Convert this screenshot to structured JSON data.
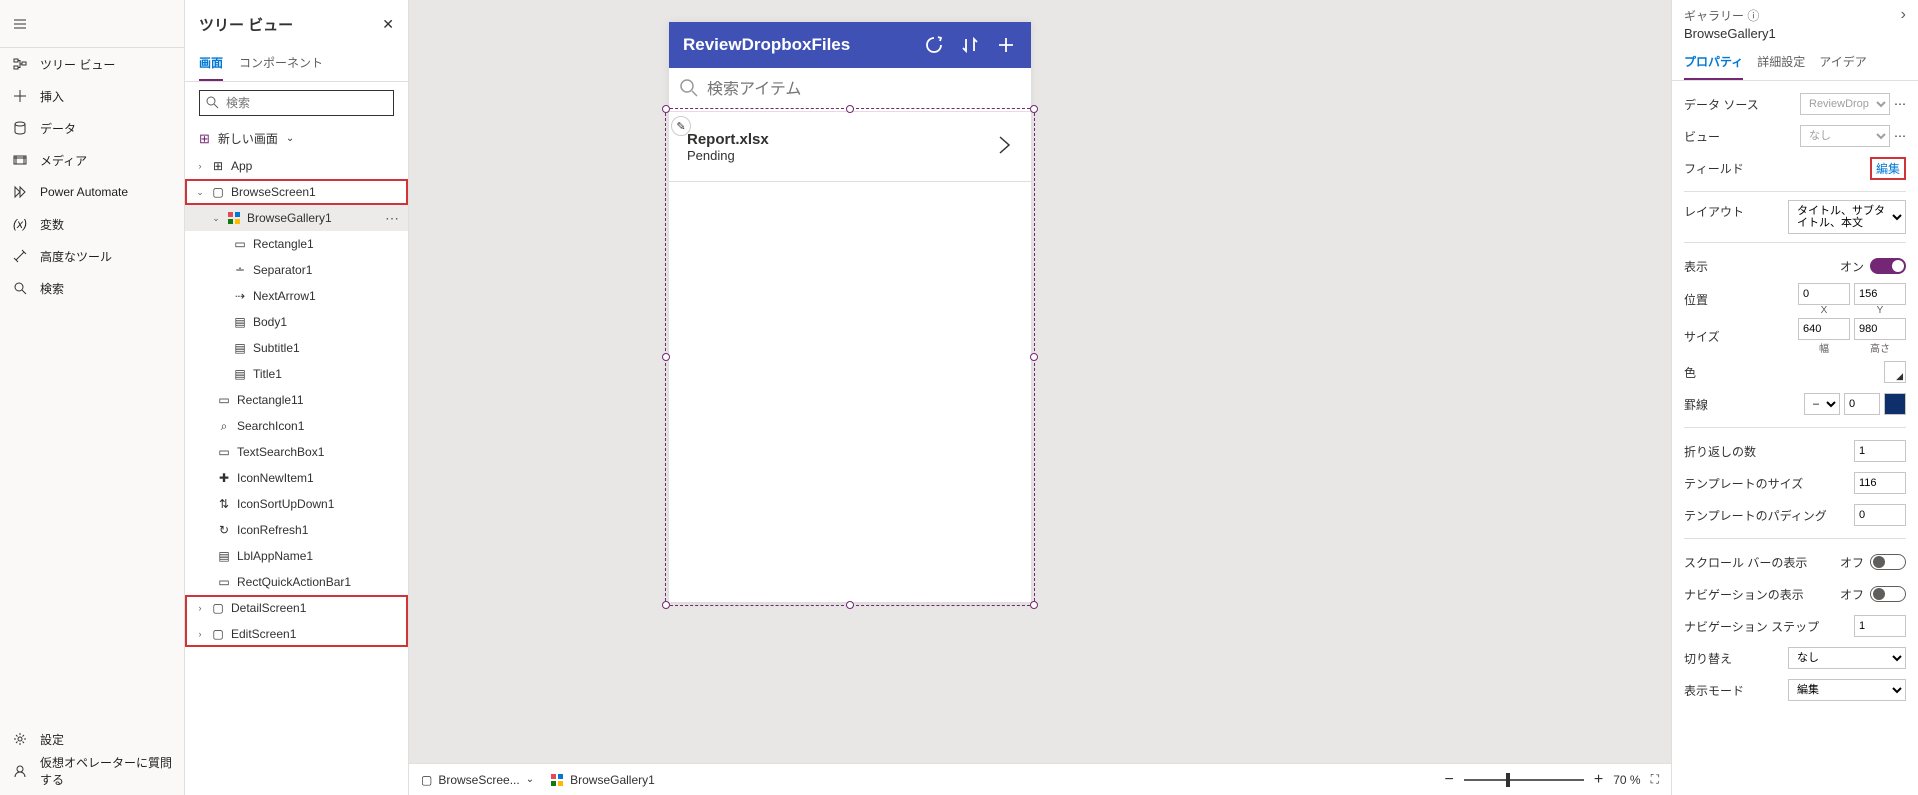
{
  "leftRail": {
    "items": [
      {
        "label": "ツリー ビュー",
        "icon": "tree"
      },
      {
        "label": "挿入",
        "icon": "plus"
      },
      {
        "label": "データ",
        "icon": "data"
      },
      {
        "label": "メディア",
        "icon": "media"
      },
      {
        "label": "Power Automate",
        "icon": "flow"
      },
      {
        "label": "変数",
        "icon": "var"
      },
      {
        "label": "高度なツール",
        "icon": "tools"
      },
      {
        "label": "検索",
        "icon": "search"
      }
    ],
    "bottom": [
      {
        "label": "設定",
        "icon": "gear"
      },
      {
        "label": "仮想オペレーターに質問する",
        "icon": "bot"
      }
    ]
  },
  "treePanel": {
    "title": "ツリー ビュー",
    "tabs": [
      "画面",
      "コンポーネント"
    ],
    "searchPlaceholder": "検索",
    "newScreen": "新しい画面",
    "nodes": {
      "app": "App",
      "browseScreen": "BrowseScreen1",
      "browseGallery": "BrowseGallery1",
      "rectangle1": "Rectangle1",
      "separator1": "Separator1",
      "nextArrow1": "NextArrow1",
      "body1": "Body1",
      "subtitle1": "Subtitle1",
      "title1": "Title1",
      "rectangle11": "Rectangle11",
      "searchIcon1": "SearchIcon1",
      "textSearchBox1": "TextSearchBox1",
      "iconNewItem1": "IconNewItem1",
      "iconSortUpDown1": "IconSortUpDown1",
      "iconRefresh1": "IconRefresh1",
      "lblAppName1": "LblAppName1",
      "rectQuickActionBar1": "RectQuickActionBar1",
      "detailScreen": "DetailScreen1",
      "editScreen": "EditScreen1"
    }
  },
  "appPreview": {
    "title": "ReviewDropboxFiles",
    "searchPlaceholder": "検索アイテム",
    "item": {
      "title": "Report.xlsx",
      "subtitle": "Pending"
    }
  },
  "bottomBar": {
    "screen": "BrowseScree...",
    "gallery": "BrowseGallery1",
    "zoom": "70",
    "zoomSuffix": "%"
  },
  "rightPanel": {
    "type": "ギャラリー",
    "name": "BrowseGallery1",
    "tabs": [
      "プロパティ",
      "詳細設定",
      "アイデア"
    ],
    "rows": {
      "dataSource": {
        "label": "データ ソース",
        "value": "ReviewDropbo..."
      },
      "view": {
        "label": "ビュー",
        "value": "なし"
      },
      "fields": {
        "label": "フィールド",
        "edit": "編集"
      },
      "layout": {
        "label": "レイアウト",
        "value": "タイトル、サブタイトル、本文"
      },
      "visible": {
        "label": "表示",
        "state": "オン"
      },
      "position": {
        "label": "位置",
        "x": "0",
        "y": "156",
        "xLabel": "X",
        "yLabel": "Y"
      },
      "size": {
        "label": "サイズ",
        "w": "640",
        "h": "980",
        "wLabel": "幅",
        "hLabel": "高さ"
      },
      "color": {
        "label": "色",
        "value": "#ffffff"
      },
      "border": {
        "label": "罫線",
        "style": "—",
        "width": "0",
        "color": "#0e2f6c"
      },
      "wrap": {
        "label": "折り返しの数",
        "value": "1"
      },
      "templateSize": {
        "label": "テンプレートのサイズ",
        "value": "116"
      },
      "templatePadding": {
        "label": "テンプレートのパディング",
        "value": "0"
      },
      "scrollbar": {
        "label": "スクロール バーの表示",
        "state": "オフ"
      },
      "navigation": {
        "label": "ナビゲーションの表示",
        "state": "オフ"
      },
      "navStep": {
        "label": "ナビゲーション ステップ",
        "value": "1"
      },
      "transition": {
        "label": "切り替え",
        "value": "なし"
      },
      "displayMode": {
        "label": "表示モード",
        "value": "編集"
      }
    }
  }
}
